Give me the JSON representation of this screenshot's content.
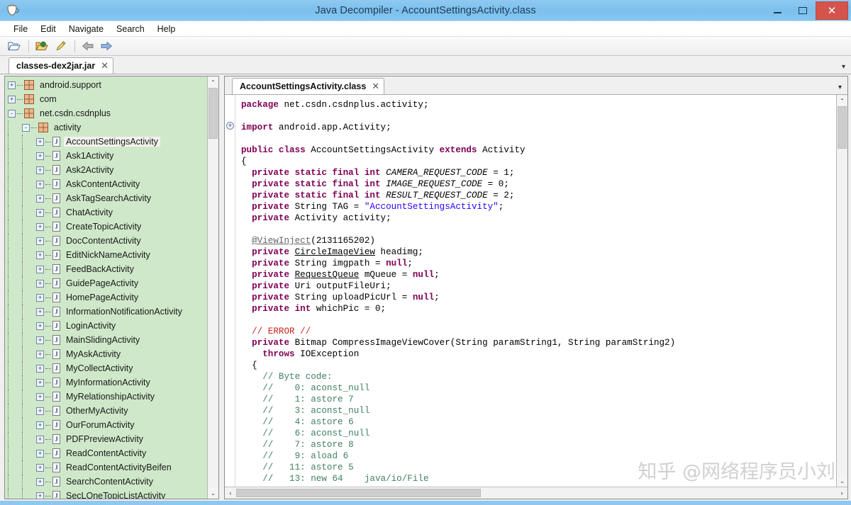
{
  "window": {
    "title": "Java Decompiler - AccountSettingsActivity.class",
    "app_icon": "coffee-cup-icon",
    "minimize_label": "–",
    "maximize_label": "□",
    "close_label": "✕"
  },
  "menubar": {
    "items": [
      {
        "label": "File"
      },
      {
        "label": "Edit"
      },
      {
        "label": "Navigate"
      },
      {
        "label": "Search"
      },
      {
        "label": "Help"
      }
    ]
  },
  "toolbar": {
    "buttons": [
      {
        "name": "open-file-icon",
        "glyph": "📂"
      },
      {
        "name": "open-type-icon",
        "glyph": "📂"
      },
      {
        "name": "highlighter-icon",
        "glyph": "✎"
      },
      {
        "name": "navigate-back-icon",
        "glyph": "←"
      },
      {
        "name": "navigate-forward-icon",
        "glyph": "→"
      }
    ]
  },
  "jar_tabs": {
    "active": "classes-dex2jar.jar",
    "close_label": "✕",
    "overflow_label": "▾"
  },
  "tree": {
    "nodes": [
      {
        "label": "android.support",
        "kind": "package",
        "depth": 0,
        "expander": "+",
        "selected": false
      },
      {
        "label": "com",
        "kind": "package",
        "depth": 0,
        "expander": "+",
        "selected": false
      },
      {
        "label": "net.csdn.csdnplus",
        "kind": "package",
        "depth": 0,
        "expander": "-",
        "selected": false
      },
      {
        "label": "activity",
        "kind": "package",
        "depth": 1,
        "expander": "-",
        "selected": false
      },
      {
        "label": "AccountSettingsActivity",
        "kind": "class",
        "depth": 2,
        "expander": "+",
        "selected": true
      },
      {
        "label": "Ask1Activity",
        "kind": "class",
        "depth": 2,
        "expander": "+",
        "selected": false
      },
      {
        "label": "Ask2Activity",
        "kind": "class",
        "depth": 2,
        "expander": "+",
        "selected": false
      },
      {
        "label": "AskContentActivity",
        "kind": "class",
        "depth": 2,
        "expander": "+",
        "selected": false
      },
      {
        "label": "AskTagSearchActivity",
        "kind": "class",
        "depth": 2,
        "expander": "+",
        "selected": false
      },
      {
        "label": "ChatActivity",
        "kind": "class",
        "depth": 2,
        "expander": "+",
        "selected": false
      },
      {
        "label": "CreateTopicActivity",
        "kind": "class",
        "depth": 2,
        "expander": "+",
        "selected": false
      },
      {
        "label": "DocContentActivity",
        "kind": "class",
        "depth": 2,
        "expander": "+",
        "selected": false
      },
      {
        "label": "EditNickNameActivity",
        "kind": "class",
        "depth": 2,
        "expander": "+",
        "selected": false
      },
      {
        "label": "FeedBackActivity",
        "kind": "class",
        "depth": 2,
        "expander": "+",
        "selected": false
      },
      {
        "label": "GuidePageActivity",
        "kind": "class",
        "depth": 2,
        "expander": "+",
        "selected": false
      },
      {
        "label": "HomePageActivity",
        "kind": "class",
        "depth": 2,
        "expander": "+",
        "selected": false
      },
      {
        "label": "InformationNotificationActivity",
        "kind": "class",
        "depth": 2,
        "expander": "+",
        "selected": false
      },
      {
        "label": "LoginActivity",
        "kind": "class",
        "depth": 2,
        "expander": "+",
        "selected": false
      },
      {
        "label": "MainSlidingActivity",
        "kind": "class",
        "depth": 2,
        "expander": "+",
        "selected": false
      },
      {
        "label": "MyAskActivity",
        "kind": "class",
        "depth": 2,
        "expander": "+",
        "selected": false
      },
      {
        "label": "MyCollectActivity",
        "kind": "class",
        "depth": 2,
        "expander": "+",
        "selected": false
      },
      {
        "label": "MyInformationActivity",
        "kind": "class",
        "depth": 2,
        "expander": "+",
        "selected": false
      },
      {
        "label": "MyRelationshipActivity",
        "kind": "class",
        "depth": 2,
        "expander": "+",
        "selected": false
      },
      {
        "label": "OtherMyActivity",
        "kind": "class",
        "depth": 2,
        "expander": "+",
        "selected": false
      },
      {
        "label": "OurForumActivity",
        "kind": "class",
        "depth": 2,
        "expander": "+",
        "selected": false
      },
      {
        "label": "PDFPreviewActivity",
        "kind": "class",
        "depth": 2,
        "expander": "+",
        "selected": false
      },
      {
        "label": "ReadContentActivity",
        "kind": "class",
        "depth": 2,
        "expander": "+",
        "selected": false
      },
      {
        "label": "ReadContentActivityBeifen",
        "kind": "class",
        "depth": 2,
        "expander": "+",
        "selected": false
      },
      {
        "label": "SearchContentActivity",
        "kind": "class",
        "depth": 2,
        "expander": "+",
        "selected": false
      },
      {
        "label": "SecLOneTopicListActivity",
        "kind": "class",
        "depth": 2,
        "expander": "+",
        "selected": false
      }
    ],
    "scroll_up_label": "⌃",
    "scroll_down_label": "⌄"
  },
  "editor": {
    "tab_label": "AccountSettingsActivity.class",
    "tab_close_label": "✕",
    "overflow_label": "▾",
    "fold_marker_label": "+",
    "scroll_up_label": "⌃",
    "scroll_down_label": "⌄",
    "scroll_left_label": "‹",
    "scroll_right_label": "›",
    "code_lines": [
      [
        {
          "t": "package",
          "c": "kw"
        },
        {
          "t": " net.csdn.csdnplus.activity;",
          "c": ""
        }
      ],
      [
        {
          "t": "",
          "c": ""
        }
      ],
      [
        {
          "t": "import",
          "c": "kw"
        },
        {
          "t": " android.app.Activity;",
          "c": ""
        }
      ],
      [
        {
          "t": "",
          "c": ""
        }
      ],
      [
        {
          "t": "public class",
          "c": "kw"
        },
        {
          "t": " AccountSettingsActivity ",
          "c": ""
        },
        {
          "t": "extends",
          "c": "kw"
        },
        {
          "t": " Activity",
          "c": ""
        }
      ],
      [
        {
          "t": "{",
          "c": ""
        }
      ],
      [
        {
          "t": "  ",
          "c": ""
        },
        {
          "t": "private static final int",
          "c": "kw"
        },
        {
          "t": " ",
          "c": ""
        },
        {
          "t": "CAMERA_REQUEST_CODE",
          "c": "fld"
        },
        {
          "t": " = 1;",
          "c": ""
        }
      ],
      [
        {
          "t": "  ",
          "c": ""
        },
        {
          "t": "private static final int",
          "c": "kw"
        },
        {
          "t": " ",
          "c": ""
        },
        {
          "t": "IMAGE_REQUEST_CODE",
          "c": "fld"
        },
        {
          "t": " = 0;",
          "c": ""
        }
      ],
      [
        {
          "t": "  ",
          "c": ""
        },
        {
          "t": "private static final int",
          "c": "kw"
        },
        {
          "t": " ",
          "c": ""
        },
        {
          "t": "RESULT_REQUEST_CODE",
          "c": "fld"
        },
        {
          "t": " = 2;",
          "c": ""
        }
      ],
      [
        {
          "t": "  ",
          "c": ""
        },
        {
          "t": "private",
          "c": "kw"
        },
        {
          "t": " String TAG = ",
          "c": ""
        },
        {
          "t": "\"AccountSettingsActivity\"",
          "c": "str"
        },
        {
          "t": ";",
          "c": ""
        }
      ],
      [
        {
          "t": "  ",
          "c": ""
        },
        {
          "t": "private",
          "c": "kw"
        },
        {
          "t": " Activity activity;",
          "c": ""
        }
      ],
      [
        {
          "t": "",
          "c": ""
        }
      ],
      [
        {
          "t": "  ",
          "c": ""
        },
        {
          "t": "@ViewInject",
          "c": "ann"
        },
        {
          "t": "(2131165202)",
          "c": ""
        }
      ],
      [
        {
          "t": "  ",
          "c": ""
        },
        {
          "t": "private",
          "c": "kw"
        },
        {
          "t": " ",
          "c": ""
        },
        {
          "t": "CircleImageView",
          "c": "lnk"
        },
        {
          "t": " headimg;",
          "c": ""
        }
      ],
      [
        {
          "t": "  ",
          "c": ""
        },
        {
          "t": "private",
          "c": "kw"
        },
        {
          "t": " String imgpath = ",
          "c": ""
        },
        {
          "t": "null",
          "c": "kw"
        },
        {
          "t": ";",
          "c": ""
        }
      ],
      [
        {
          "t": "  ",
          "c": ""
        },
        {
          "t": "private",
          "c": "kw"
        },
        {
          "t": " ",
          "c": ""
        },
        {
          "t": "RequestQueue",
          "c": "lnk"
        },
        {
          "t": " mQueue = ",
          "c": ""
        },
        {
          "t": "null",
          "c": "kw"
        },
        {
          "t": ";",
          "c": ""
        }
      ],
      [
        {
          "t": "  ",
          "c": ""
        },
        {
          "t": "private",
          "c": "kw"
        },
        {
          "t": " Uri outputFileUri;",
          "c": ""
        }
      ],
      [
        {
          "t": "  ",
          "c": ""
        },
        {
          "t": "private",
          "c": "kw"
        },
        {
          "t": " String uploadPicUrl = ",
          "c": ""
        },
        {
          "t": "null",
          "c": "kw"
        },
        {
          "t": ";",
          "c": ""
        }
      ],
      [
        {
          "t": "  ",
          "c": ""
        },
        {
          "t": "private",
          "c": "kw"
        },
        {
          "t": " ",
          "c": ""
        },
        {
          "t": "int",
          "c": "kw"
        },
        {
          "t": " whichPic = 0;",
          "c": ""
        }
      ],
      [
        {
          "t": "",
          "c": ""
        }
      ],
      [
        {
          "t": "  ",
          "c": ""
        },
        {
          "t": "// ERROR //",
          "c": "err"
        }
      ],
      [
        {
          "t": "  ",
          "c": ""
        },
        {
          "t": "private",
          "c": "kw"
        },
        {
          "t": " Bitmap CompressImageViewCover(String paramString1, String paramString2)",
          "c": ""
        }
      ],
      [
        {
          "t": "    ",
          "c": ""
        },
        {
          "t": "throws",
          "c": "kw"
        },
        {
          "t": " IOException",
          "c": ""
        }
      ],
      [
        {
          "t": "  {",
          "c": ""
        }
      ],
      [
        {
          "t": "    ",
          "c": ""
        },
        {
          "t": "// Byte code:",
          "c": "cmt"
        }
      ],
      [
        {
          "t": "    ",
          "c": ""
        },
        {
          "t": "//    0: aconst_null",
          "c": "cmt"
        }
      ],
      [
        {
          "t": "    ",
          "c": ""
        },
        {
          "t": "//    1: astore 7",
          "c": "cmt"
        }
      ],
      [
        {
          "t": "    ",
          "c": ""
        },
        {
          "t": "//    3: aconst_null",
          "c": "cmt"
        }
      ],
      [
        {
          "t": "    ",
          "c": ""
        },
        {
          "t": "//    4: astore 6",
          "c": "cmt"
        }
      ],
      [
        {
          "t": "    ",
          "c": ""
        },
        {
          "t": "//    6: aconst_null",
          "c": "cmt"
        }
      ],
      [
        {
          "t": "    ",
          "c": ""
        },
        {
          "t": "//    7: astore 8",
          "c": "cmt"
        }
      ],
      [
        {
          "t": "    ",
          "c": ""
        },
        {
          "t": "//    9: aload 6",
          "c": "cmt"
        }
      ],
      [
        {
          "t": "    ",
          "c": ""
        },
        {
          "t": "//   11: astore 5",
          "c": "cmt"
        }
      ],
      [
        {
          "t": "    ",
          "c": ""
        },
        {
          "t": "//   13: new 64    java/io/File",
          "c": "cmt"
        }
      ]
    ]
  },
  "watermark": {
    "text": "知乎 @网络程序员小刘"
  },
  "colors": {
    "titlebar": "#86c6f0",
    "tree_background": "#cfe8c9",
    "keyword": "#7f0055",
    "string": "#2a00ff",
    "comment": "#3f7f5f",
    "error": "#cc2222",
    "close_button": "#d4534c"
  }
}
